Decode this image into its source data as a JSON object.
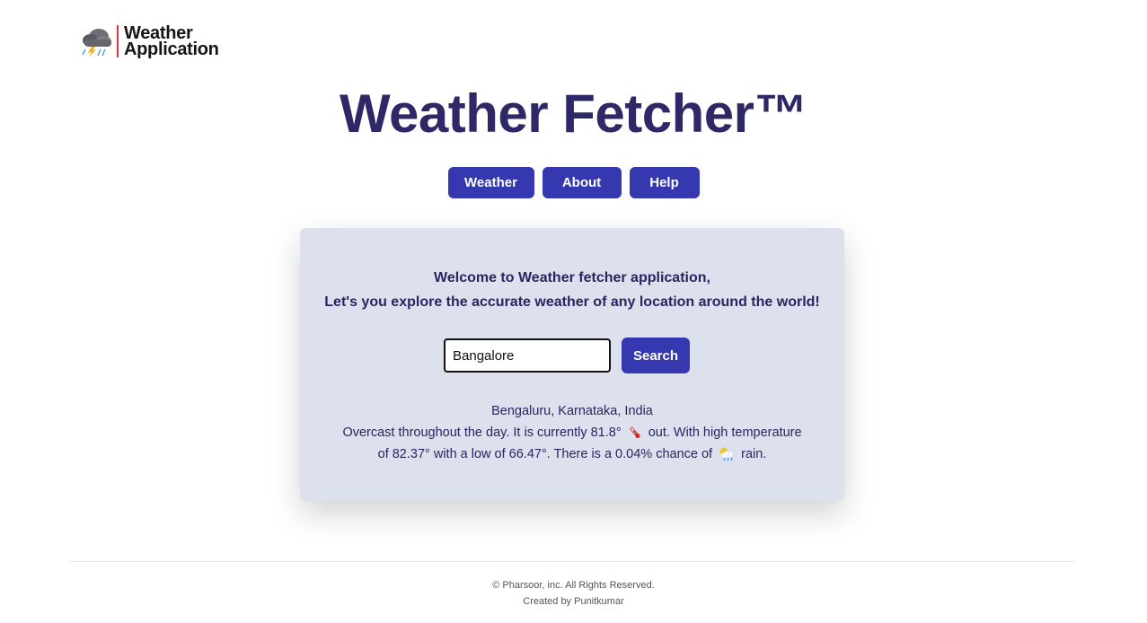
{
  "logo": {
    "icon": "storm-cloud-icon",
    "line1": "Weather",
    "line2": "Application"
  },
  "title": "Weather Fetcher™",
  "nav": [
    {
      "label": "Weather"
    },
    {
      "label": "About"
    },
    {
      "label": "Help"
    }
  ],
  "card": {
    "welcome_line1": "Welcome to Weather fetcher application,",
    "welcome_line2": "Let's you explore the accurate weather of any location around the world!",
    "search": {
      "value": "Bangalore",
      "button_label": "Search"
    },
    "result": {
      "location": "Bengaluru, Karnataka, India",
      "line2_part1": "Overcast throughout the day. It is currently 81.8°",
      "line2_part2": "out. With high temperature",
      "line3_part1": "of 82.37° with a low of 66.47°. There is a 0.04% chance of",
      "line3_part2": "rain.",
      "thermometer_icon": "thermometer-icon",
      "rain_icon": "sun-rain-cloud-icon"
    }
  },
  "footer": {
    "copyright": "© Pharsoor, inc. All Rights Reserved.",
    "credit": "Created by Punitkumar"
  },
  "colors": {
    "title": "#2e2867",
    "button": "#3638b0",
    "card_bg": "#dde1ee",
    "text": "#2a2560"
  }
}
